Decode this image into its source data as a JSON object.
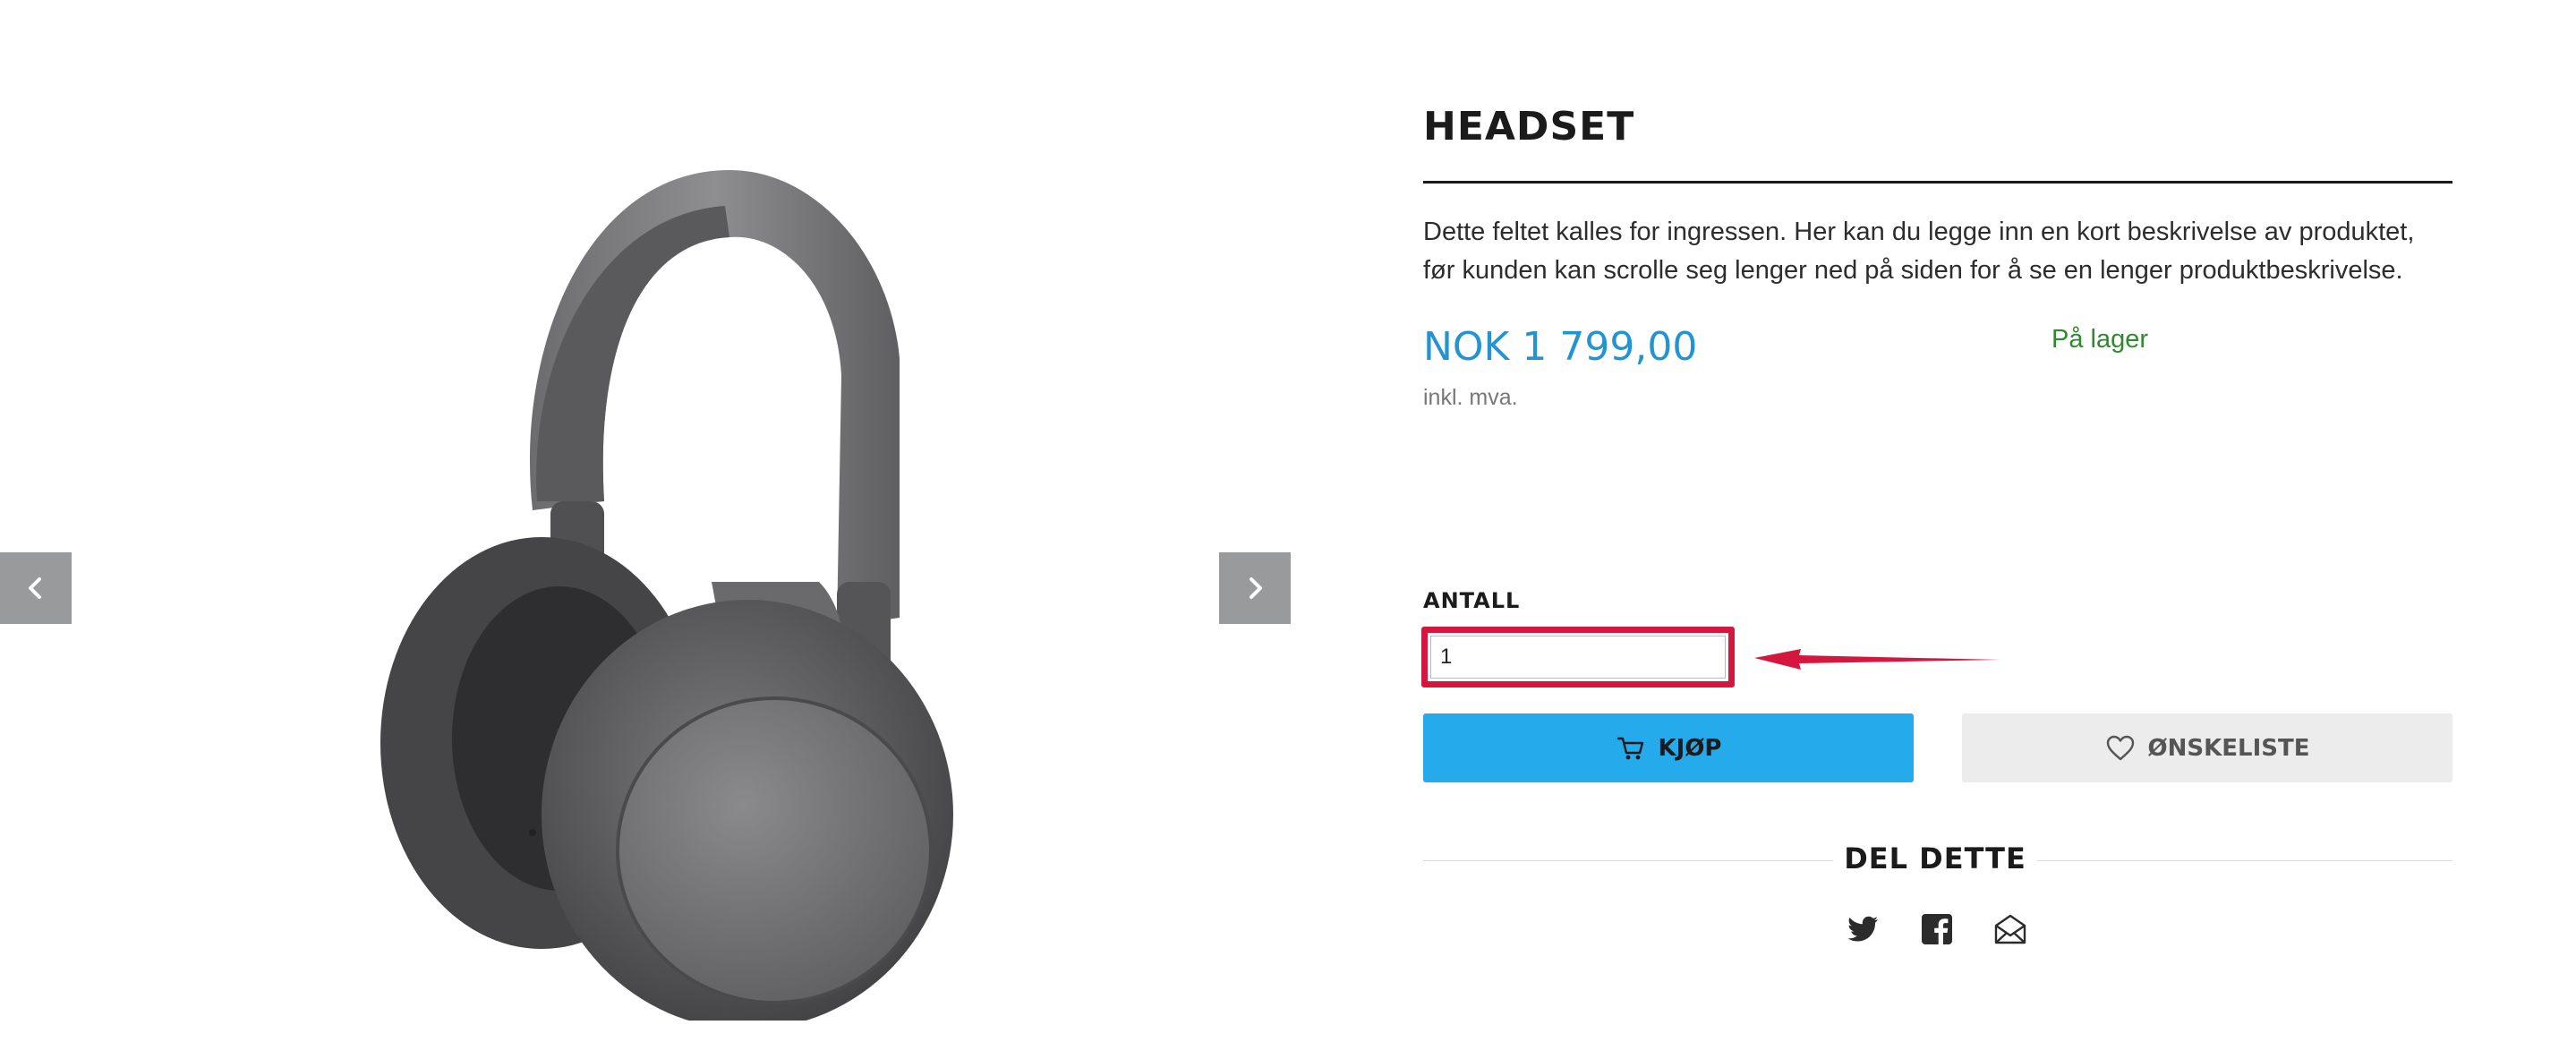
{
  "product": {
    "title": "HEADSET",
    "ingress": "Dette feltet kalles for ingressen. Her kan du legge inn en kort beskrivelse av produktet, før kunden kan scrolle seg lenger ned på siden for å se en lenger produktbeskrivelse.",
    "price": "NOK 1 799,00",
    "vat_note": "inkl. mva.",
    "stock": "På lager"
  },
  "quantity": {
    "label": "ANTALL",
    "value": "1"
  },
  "actions": {
    "buy_label": "KJØP",
    "wishlist_label": "ØNSKELISTE"
  },
  "share": {
    "title": "DEL DETTE",
    "icons": [
      "twitter-icon",
      "facebook-icon",
      "mail-icon"
    ]
  },
  "gallery": {
    "icons": [
      "chevron-left-icon",
      "chevron-right-icon"
    ]
  },
  "colors": {
    "price": "#2493cf",
    "stock": "#2f8a2f",
    "buy_button": "#25aaeb",
    "wishlist_button": "#ececec",
    "highlight": "#d5173f"
  }
}
